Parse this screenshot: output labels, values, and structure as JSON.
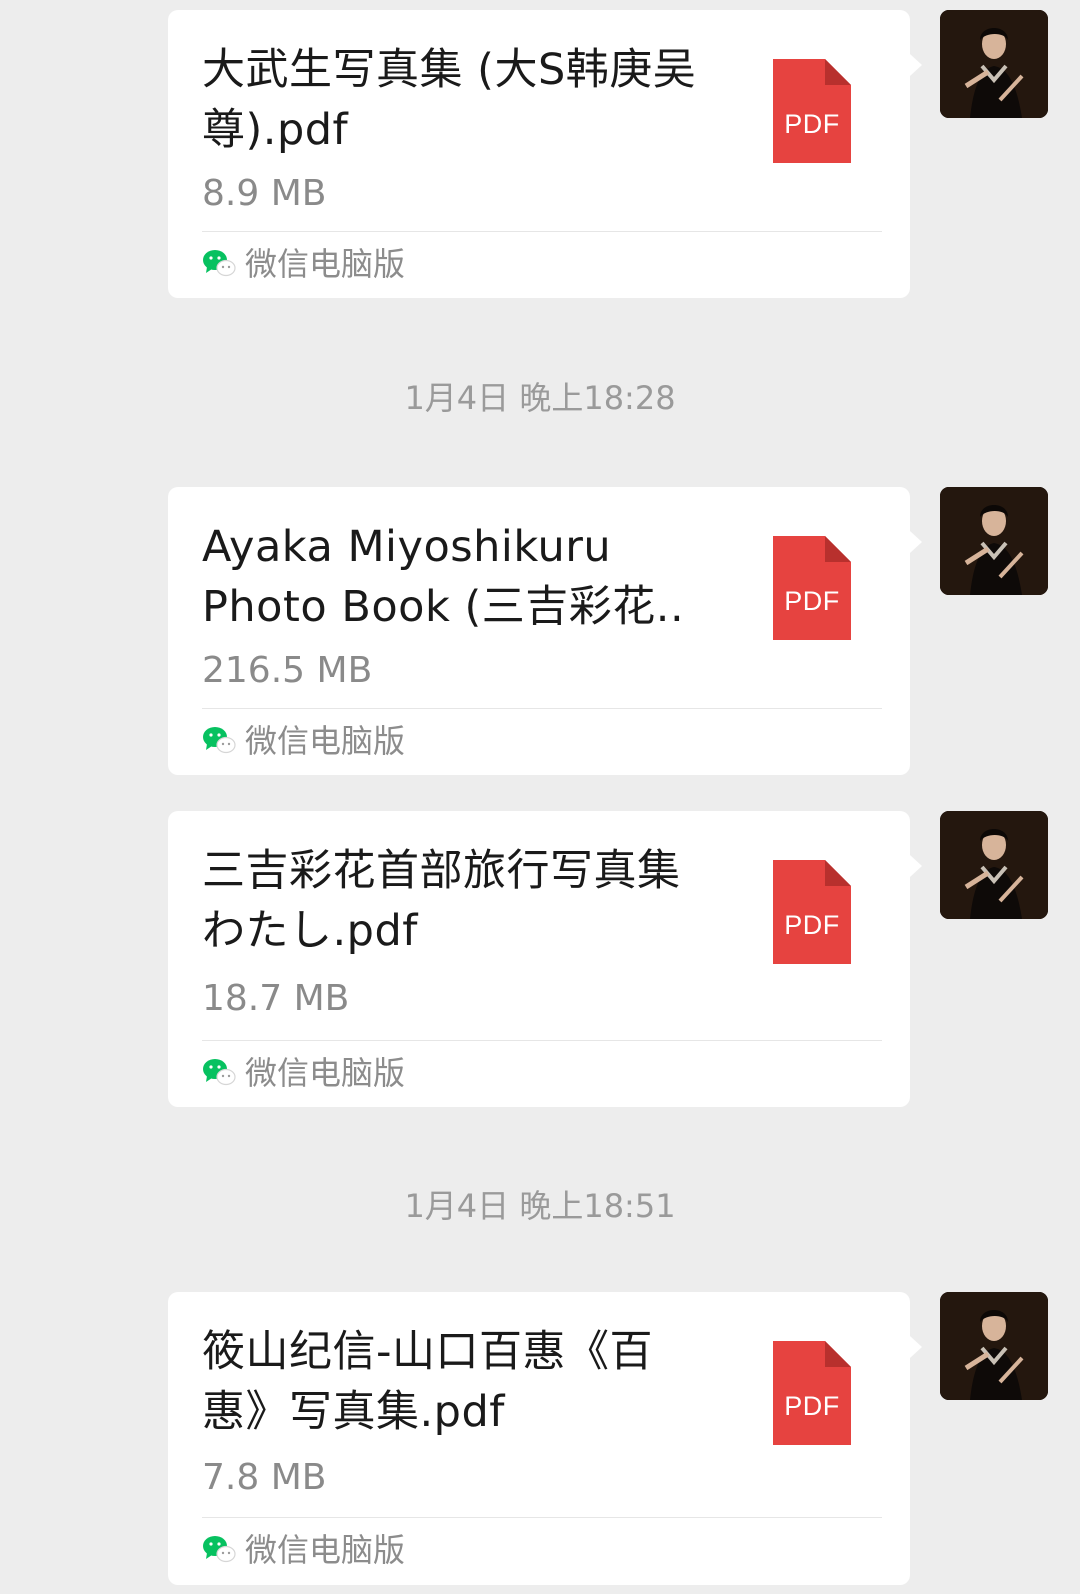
{
  "messages": [
    {
      "file_name": "大武生写真集 (大S韩庚吴尊).pdf",
      "file_size": "8.9 MB",
      "file_type": "PDF",
      "source": "微信电脑版"
    },
    {
      "file_name": "Ayaka Miyoshikuru Photo Book (三吉彩花..",
      "file_size": "216.5 MB",
      "file_type": "PDF",
      "source": "微信电脑版"
    },
    {
      "file_name": "三吉彩花首部旅行写真集わたし.pdf",
      "file_size": "18.7 MB",
      "file_type": "PDF",
      "source": "微信电脑版"
    },
    {
      "file_name": "筱山纪信-山口百惠《百惠》写真集.pdf",
      "file_size": "7.8 MB",
      "file_type": "PDF",
      "source": "微信电脑版"
    }
  ],
  "timestamps": [
    "1月4日 晚上18:28",
    "1月4日 晚上18:51"
  ],
  "colors": {
    "background": "#ededed",
    "bubble": "#ffffff",
    "pdf_red": "#e64340",
    "wechat_green": "#07c160"
  },
  "icons": {
    "file_type_icon": "pdf-file-icon",
    "source_icon": "wechat-icon",
    "avatar": "user-avatar"
  }
}
